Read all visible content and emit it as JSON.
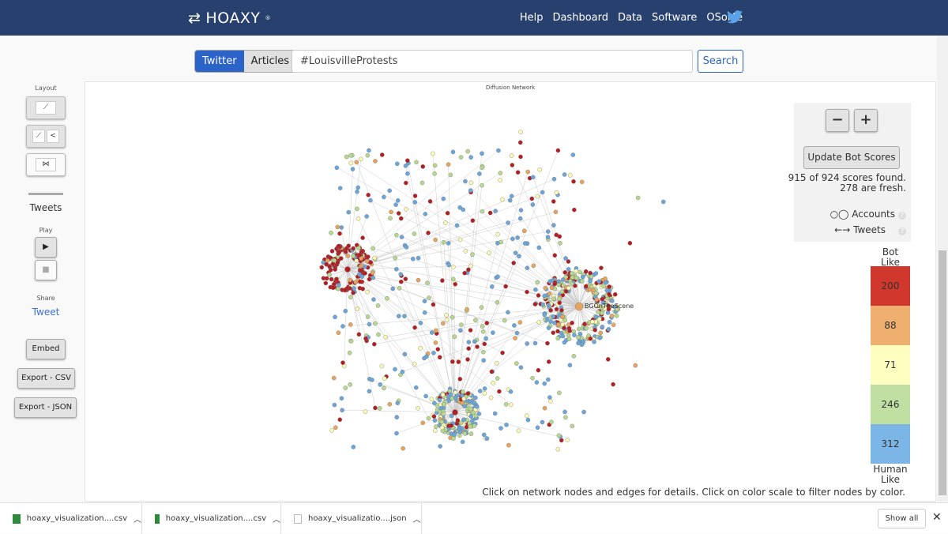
{
  "header": {
    "logo": "HOAXY",
    "logo_mark": "®",
    "nav": [
      "Help",
      "Dashboard",
      "Data",
      "Software",
      "OSoMe"
    ]
  },
  "search": {
    "tabs": [
      "Twitter",
      "Articles"
    ],
    "active_tab": "Twitter",
    "query": "#LouisvilleProtests",
    "button": "Search"
  },
  "sidebar": {
    "layout_label": "Layout",
    "tweets_label": "Tweets",
    "play_label": "Play",
    "share_label": "Share",
    "tweet_link": "Tweet",
    "embed": "Embed",
    "export_csv": "Export - CSV",
    "export_json": "Export - JSON"
  },
  "graph": {
    "title": "Diffusion Network",
    "hub_label": "BGOnTheScene",
    "footer": "Click on network nodes and edges for details. Click on color scale to filter nodes by color."
  },
  "controls": {
    "zoom_out": "−",
    "zoom_in": "+",
    "update": "Update Bot Scores",
    "found": "915 of 924 scores found.",
    "fresh": "278 are fresh.",
    "accounts": "Accounts",
    "tweets": "Tweets"
  },
  "scale": {
    "top": "Bot\nLike",
    "bottom": "Human\nLike",
    "bins": [
      {
        "count": "200",
        "color": "#d0382e"
      },
      {
        "count": "88",
        "color": "#efb06f"
      },
      {
        "count": "71",
        "color": "#fefec0"
      },
      {
        "count": "246",
        "color": "#bfe0a2"
      },
      {
        "count": "312",
        "color": "#7cb6e6"
      }
    ]
  },
  "node_colors": [
    "#b51d22",
    "#e8a45d",
    "#fbfbb5",
    "#b6d98f",
    "#6aa6dc"
  ],
  "downloads": {
    "files": [
      "hoaxy_visualization....csv",
      "hoaxy_visualization....csv",
      "hoaxy_visualizatio....json"
    ],
    "show_all": "Show all"
  }
}
